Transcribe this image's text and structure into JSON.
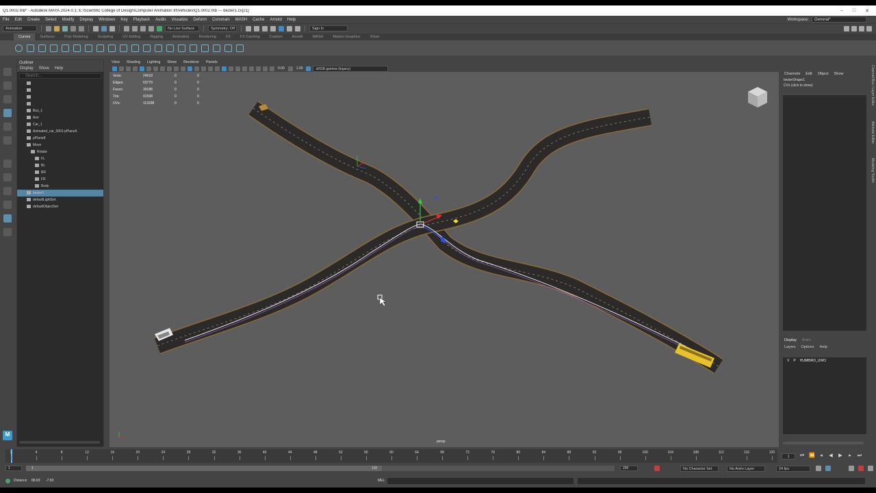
{
  "title": {
    "text": "Q1.0002.mb* - Autodesk MAYA 2024.0.1: E:\\Scientific College of Design\\Computer Animation III\\Vehicles\\Q1.0002.mb  ---  bezier1.cv[21]"
  },
  "menubar": {
    "items": [
      "File",
      "Edit",
      "Create",
      "Select",
      "Modify",
      "Display",
      "Windows",
      "Key",
      "Playback",
      "Audio",
      "Visualize",
      "Deform",
      "Constrain",
      "MASH",
      "Cache",
      "Arnold",
      "Help"
    ],
    "workspace_label": "Workspace:",
    "workspace_value": "General*"
  },
  "statusline": {
    "mode": "Animation",
    "live_surface": "No Live Surface",
    "symmetry": "Symmetry: Off",
    "sign_in": "Sign In"
  },
  "shelf": {
    "tabs": [
      "Curves",
      "Surfaces",
      "Poly Modeling",
      "Sculpting",
      "UV Editing",
      "Rigging",
      "Animation",
      "Rendering",
      "FX",
      "FX Caching",
      "Custom",
      "Arnold",
      "MASH",
      "Motion Graphics",
      "XGen"
    ],
    "active_tab": 0
  },
  "outliner": {
    "title": "Outliner",
    "menus": [
      "Display",
      "Show",
      "Help"
    ],
    "search_placeholder": "Search...",
    "items": [
      {
        "label": "",
        "indent": 1
      },
      {
        "label": "",
        "indent": 1
      },
      {
        "label": "",
        "indent": 1
      },
      {
        "label": "",
        "indent": 1
      },
      {
        "label": "Bus_1",
        "indent": 1
      },
      {
        "label": "Axe",
        "indent": 1
      },
      {
        "label": "Car_1",
        "indent": 1
      },
      {
        "label": "Animated_car_0001:pPlane6",
        "indent": 1
      },
      {
        "label": "pPlane8",
        "indent": 1
      },
      {
        "label": "Move",
        "indent": 1
      },
      {
        "label": "Rotate",
        "indent": 2
      },
      {
        "label": "FL",
        "indent": 3
      },
      {
        "label": "BL",
        "indent": 3
      },
      {
        "label": "BR",
        "indent": 3
      },
      {
        "label": "FR",
        "indent": 3
      },
      {
        "label": "Body",
        "indent": 3
      },
      {
        "label": "bezier1",
        "indent": 1,
        "selected": true
      },
      {
        "label": "defaultLightSet",
        "indent": 1
      },
      {
        "label": "defaultObjectSet",
        "indent": 1
      }
    ]
  },
  "viewport": {
    "menus": [
      "View",
      "Shading",
      "Lighting",
      "Show",
      "Renderer",
      "Panels"
    ],
    "near_value": "0.00",
    "far_value": "1.00",
    "color_space": "sRGB gamma (legacy)",
    "camera_label": "persp",
    "hud": [
      {
        "label": "Verts:",
        "v1": "24618",
        "v2": "0",
        "v3": "0"
      },
      {
        "label": "Edges:",
        "v1": "63779",
        "v2": "0",
        "v3": "0"
      },
      {
        "label": "Faces:",
        "v1": "39188",
        "v2": "0",
        "v3": "0"
      },
      {
        "label": "Tris:",
        "v1": "41598",
        "v2": "0",
        "v3": "0"
      },
      {
        "label": "UVs:",
        "v1": "113298",
        "v2": "0",
        "v3": "0"
      }
    ]
  },
  "channelbox": {
    "menus": [
      "Channels",
      "Edit",
      "Object",
      "Show"
    ],
    "shape_name": "bezierShape1",
    "cvs_hint": "CVs (click to show)"
  },
  "right_strip": {
    "labels": [
      "Channel Box / Layer Editor",
      "Attribute Editor",
      "Modeling Toolkit"
    ]
  },
  "layers": {
    "tabs": [
      "Display",
      "Anim"
    ],
    "menus": [
      "Layers",
      "Options",
      "Help"
    ],
    "rows": [
      {
        "v": "V",
        "p": "P",
        "name": "HUMBIRD_UWO"
      }
    ]
  },
  "timeline": {
    "labels": [
      "1",
      "4",
      "8",
      "12",
      "16",
      "20",
      "24",
      "28",
      "32",
      "36",
      "40",
      "44",
      "48",
      "52",
      "56",
      "60",
      "64",
      "68",
      "72",
      "76",
      "80",
      "84",
      "88",
      "92",
      "96",
      "100",
      "104",
      "108",
      "112",
      "116",
      "120"
    ],
    "current_frame": "1"
  },
  "range": {
    "start": "1",
    "inner_start": "1",
    "inner_end": "120",
    "end": "200",
    "character_set": "No Character Set",
    "anim_layer": "No Anim Layer",
    "fps": "24 fps"
  },
  "cmdline": {
    "distance_label": "Distance",
    "distance_value": "88.83",
    "distance_value2": "-7.83",
    "mel_label": "MEL"
  },
  "colors": {
    "accent": "#5285a6",
    "viewport_bg": "#5d5d5d",
    "road": "#2b2a28",
    "road_edge": "#8a6a3a",
    "bus": "#e8c22b"
  }
}
